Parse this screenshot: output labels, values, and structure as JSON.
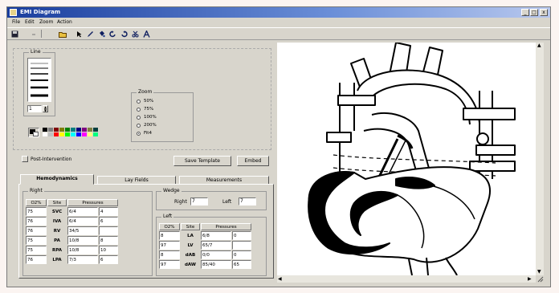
{
  "window": {
    "title": "EMI Diagram",
    "icon": "app-icon",
    "controls": [
      "_",
      "□",
      "x"
    ]
  },
  "menu": {
    "items": [
      "File",
      "Edit",
      "Zoom",
      "Action"
    ]
  },
  "toolbar": {
    "icons": [
      "save-icon",
      "undo-icon",
      "open-folder-icon",
      "pointer-icon",
      "pencil-icon",
      "fill-icon",
      "rotate-left-icon",
      "rotate-right-icon",
      "scissors-icon",
      "text-icon"
    ]
  },
  "line_group": {
    "label": "Line",
    "width_value": "1"
  },
  "zoom_group": {
    "label": "Zoom",
    "options": [
      "50%",
      "75%",
      "100%",
      "200%",
      "Fit4"
    ],
    "selected": "Fit4"
  },
  "palette": {
    "colors": [
      "#000000",
      "#7f7f7f",
      "#7f0000",
      "#7f7f00",
      "#007f00",
      "#007f7f",
      "#00007f",
      "#7f007f",
      "#7f7f3f",
      "#003f3f",
      "#ffffff",
      "#bfbfbf",
      "#ff0000",
      "#ffff00",
      "#00ff00",
      "#00ffff",
      "#0000ff",
      "#ff00ff",
      "#ffff7f",
      "#00ff7f"
    ]
  },
  "post_intervention": {
    "label": "Post-Intervention"
  },
  "buttons": {
    "save_template": "Save Template",
    "embed": "Embed"
  },
  "tabs": [
    "Hemodynamics",
    "Lay Fields",
    "Measurements"
  ],
  "right_group": {
    "label": "Right",
    "headers": [
      "O2%",
      "Site",
      "Pressures"
    ],
    "rows": [
      {
        "o2": "75",
        "site": "SVC",
        "p1": "6/4",
        "p2": "4"
      },
      {
        "o2": "76",
        "site": "IVA",
        "p1": "6/4",
        "p2": "6"
      },
      {
        "o2": "76",
        "site": "RV",
        "p1": "34/5",
        "p2": ""
      },
      {
        "o2": "75",
        "site": "PA",
        "p1": "10/8",
        "p2": "8"
      },
      {
        "o2": "75",
        "site": "RPA",
        "p1": "10/8",
        "p2": "10"
      },
      {
        "o2": "76",
        "site": "LPA",
        "p1": "7/3",
        "p2": "6"
      }
    ]
  },
  "wedge_group": {
    "label": "Wedge",
    "right_label": "Right",
    "right_value": "7",
    "left_label": "Left",
    "left_value": "7"
  },
  "left_group": {
    "label": "Left",
    "headers": [
      "O2%",
      "Site",
      "Pressures"
    ],
    "rows": [
      {
        "o2": "8",
        "site": "LA",
        "p1": "6/8",
        "p2": "0"
      },
      {
        "o2": "97",
        "site": "LV",
        "p1": "65/7",
        "p2": ""
      },
      {
        "o2": "8",
        "site": "dAB",
        "p1": "0/0",
        "p2": "0"
      },
      {
        "o2": "97",
        "site": "dAW",
        "p1": "85/40",
        "p2": "65"
      }
    ]
  }
}
